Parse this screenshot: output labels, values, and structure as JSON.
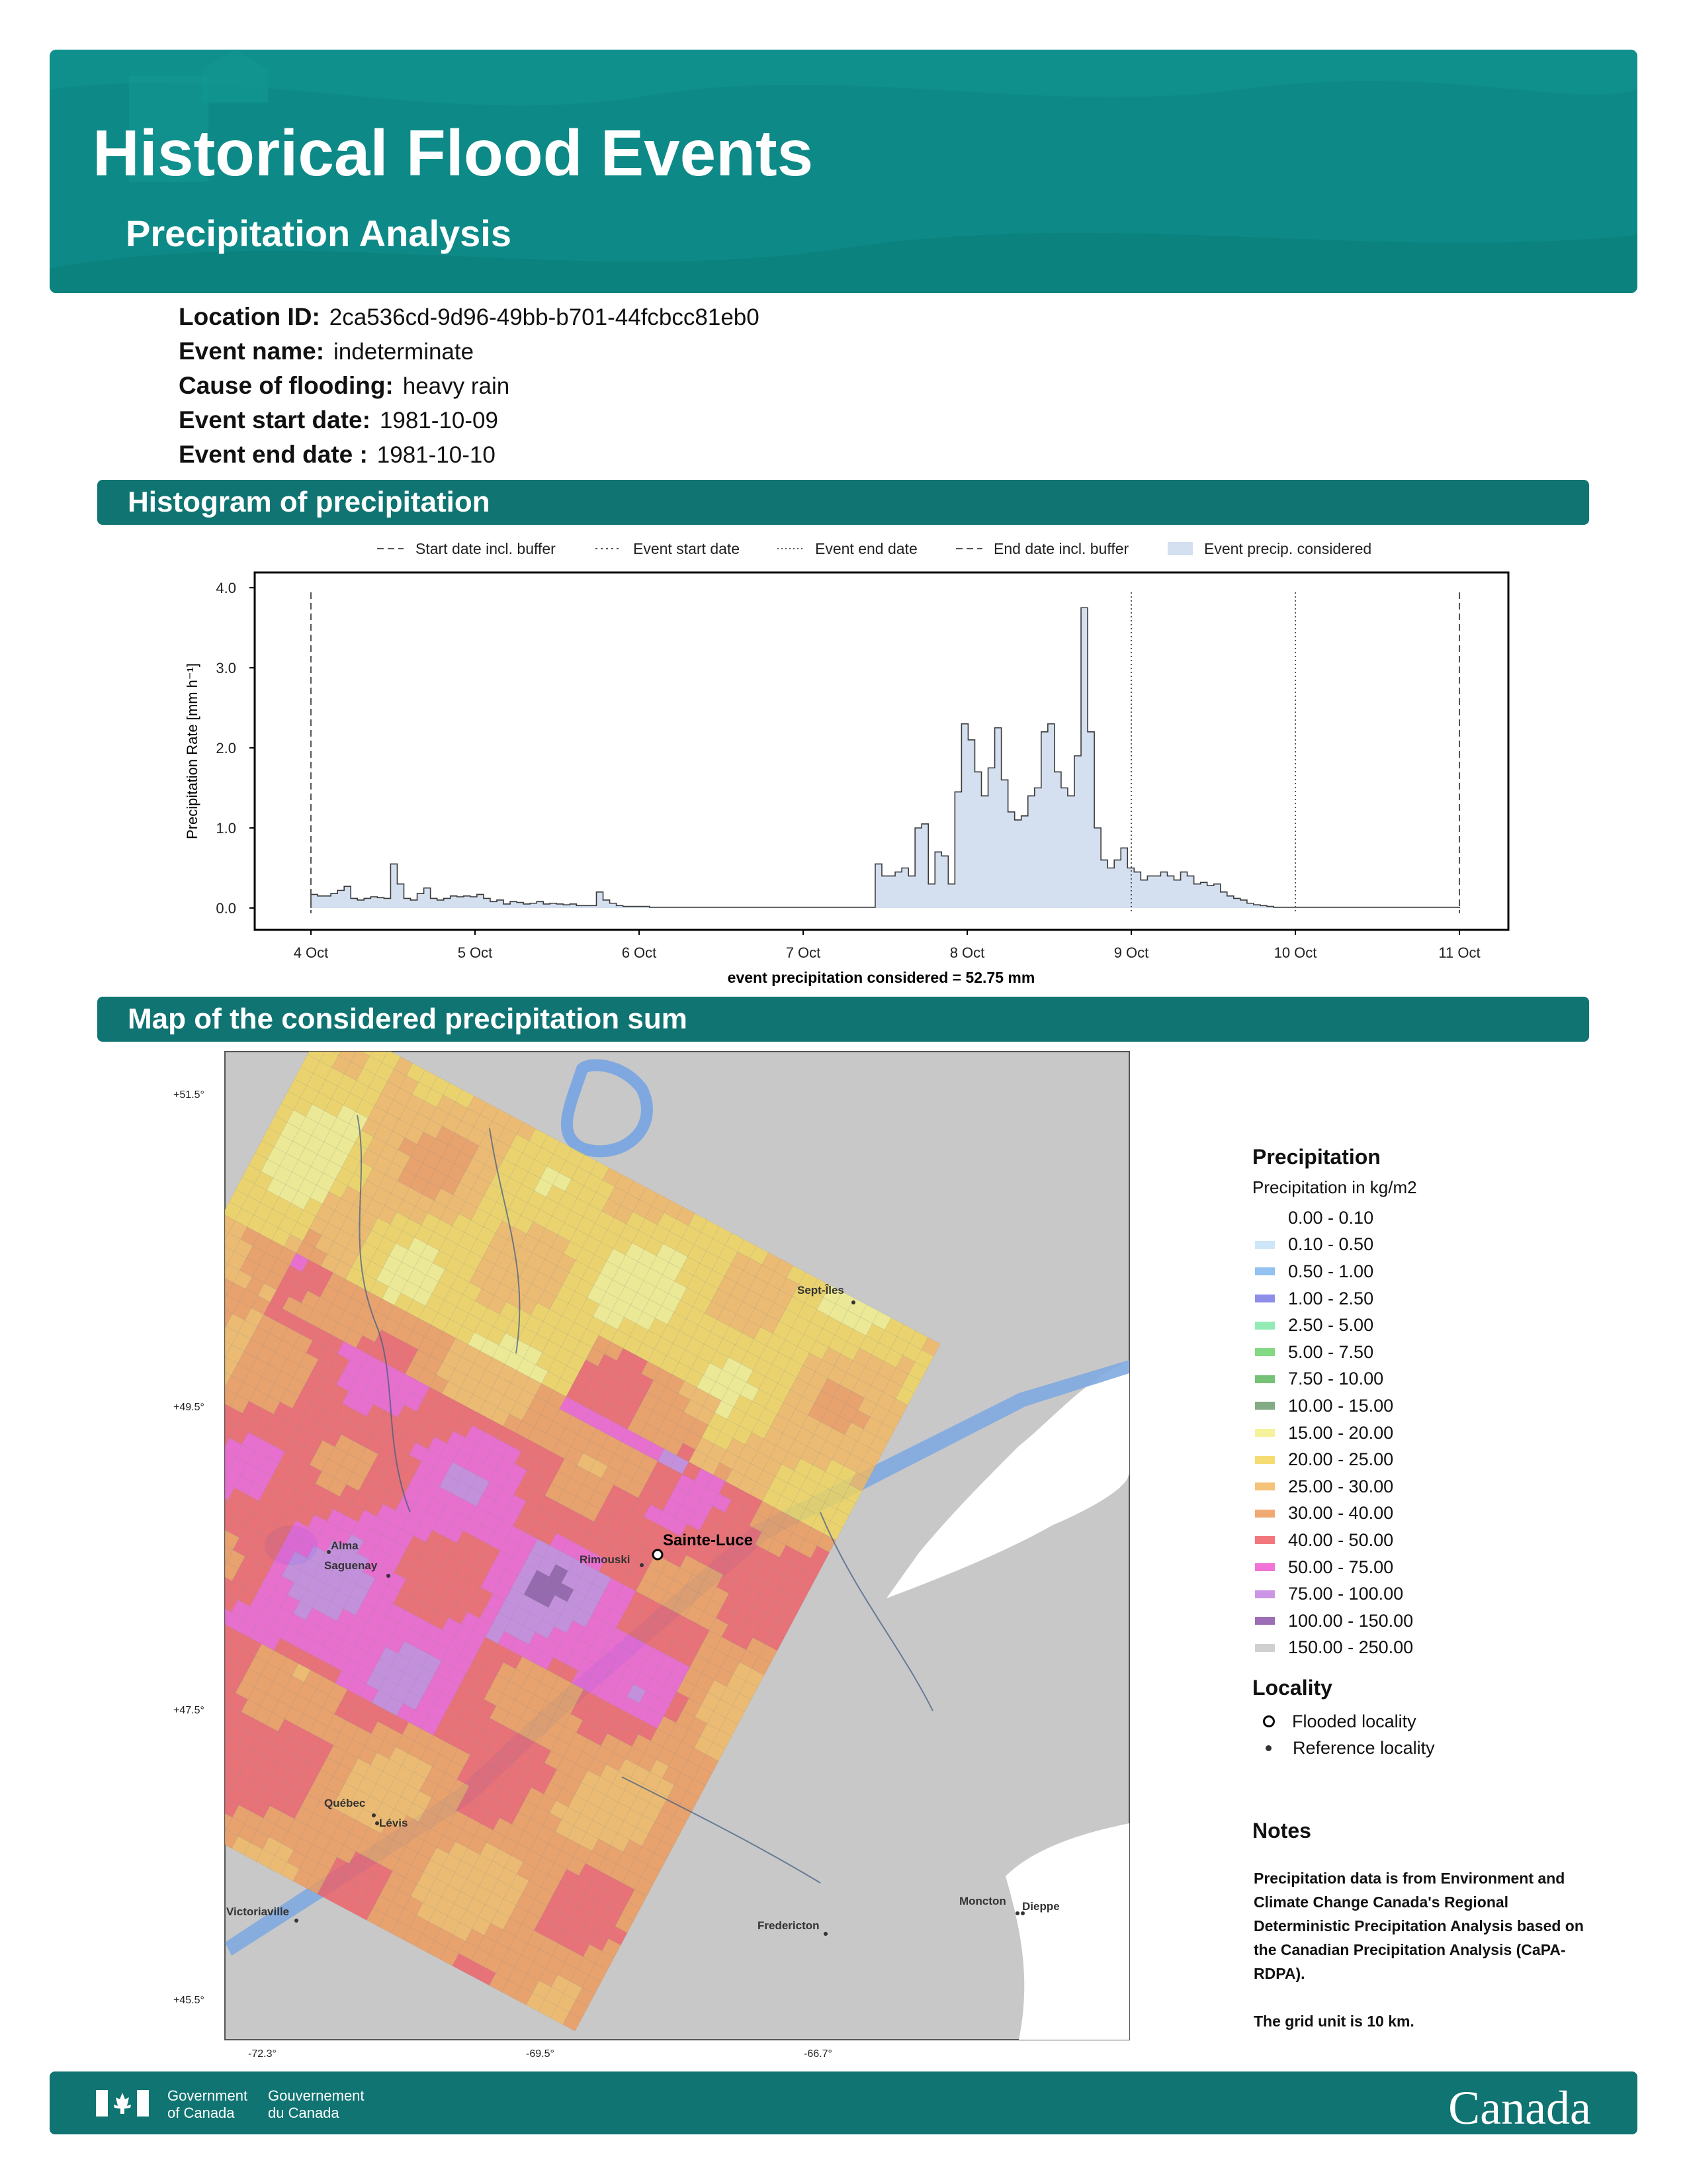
{
  "header": {
    "title": "Historical Flood Events",
    "subtitle": "Precipitation Analysis",
    "bg_color": "#0d8a87"
  },
  "meta": {
    "location_label": "Location ID:",
    "location_value": "2ca536cd-9d96-49bb-b701-44fcbcc81eb0",
    "event_label": "Event name:",
    "event_value": "indeterminate",
    "cause_label": "Cause of flooding:",
    "cause_value": "heavy rain",
    "start_label": "Event start date:",
    "start_value": "1981-10-09",
    "end_label": "Event end date :",
    "end_value": "1981-10-10"
  },
  "sections": {
    "histogram": "Histogram of precipitation",
    "map": "Map of the considered precipitation sum"
  },
  "chart_data": {
    "type": "area",
    "ylabel": "Precipitation Rate [mm h⁻¹]",
    "xlabel": "event precipitation considered = 52.75 mm",
    "ylim": [
      0,
      4.0
    ],
    "yticks": [
      "0.0",
      "1.0",
      "2.0",
      "3.0",
      "4.0"
    ],
    "xticks": [
      "4 Oct",
      "5 Oct",
      "6 Oct",
      "7 Oct",
      "8 Oct",
      "9 Oct",
      "10 Oct",
      "11 Oct"
    ],
    "legend": [
      "Start date incl. buffer",
      "Event start date",
      "Event end date",
      "End date incl. buffer",
      "Event precip. considered"
    ],
    "vlines": [
      {
        "name": "Start date incl. buffer",
        "x_day": 0.0,
        "style": "dashed"
      },
      {
        "name": "Event end date",
        "x_day": 5.0,
        "style": "dotted"
      },
      {
        "name": "Event start date",
        "x_day": 6.0,
        "style": "dotted"
      },
      {
        "name": "End date incl. buffer",
        "x_day": 7.0,
        "style": "dashed"
      }
    ],
    "series": [
      {
        "name": "Event precip. considered",
        "values": [
          0.17,
          0.15,
          0.15,
          0.18,
          0.22,
          0.27,
          0.12,
          0.1,
          0.12,
          0.14,
          0.13,
          0.12,
          0.55,
          0.3,
          0.12,
          0.1,
          0.18,
          0.25,
          0.12,
          0.1,
          0.12,
          0.15,
          0.14,
          0.15,
          0.14,
          0.17,
          0.12,
          0.08,
          0.1,
          0.05,
          0.08,
          0.07,
          0.05,
          0.06,
          0.08,
          0.05,
          0.06,
          0.05,
          0.04,
          0.05,
          0.03,
          0.03,
          0.03,
          0.2,
          0.1,
          0.06,
          0.03,
          0.02,
          0.02,
          0.02,
          0.02,
          0.01,
          0.01,
          0.01,
          0.01,
          0.01,
          0.01,
          0.01,
          0.01,
          0.01,
          0.01,
          0.01,
          0.01,
          0.01,
          0.01,
          0.01,
          0.01,
          0.01,
          0.01,
          0.01,
          0.01,
          0.01,
          0.01,
          0.01,
          0.01,
          0.01,
          0.01,
          0.01,
          0.01,
          0.01,
          0.01,
          0.01,
          0.01,
          0.01,
          0.01,
          0.55,
          0.4,
          0.4,
          0.45,
          0.5,
          0.4,
          1.0,
          1.05,
          0.3,
          0.7,
          0.65,
          0.3,
          1.45,
          2.3,
          2.1,
          1.7,
          1.4,
          1.75,
          2.25,
          1.6,
          1.2,
          1.1,
          1.15,
          1.4,
          1.5,
          2.2,
          2.3,
          1.7,
          1.5,
          1.4,
          1.9,
          3.75,
          2.2,
          1.0,
          0.6,
          0.5,
          0.6,
          0.75,
          0.5,
          0.45,
          0.35,
          0.4,
          0.4,
          0.45,
          0.4,
          0.35,
          0.45,
          0.4,
          0.3,
          0.32,
          0.28,
          0.3,
          0.2,
          0.15,
          0.12,
          0.1,
          0.06,
          0.04,
          0.03,
          0.02,
          0.01,
          0.01,
          0.01,
          0.01,
          0.01,
          0.01,
          0.01,
          0.01,
          0.01,
          0.01,
          0.01,
          0.01,
          0.01,
          0.01,
          0.01,
          0.01,
          0.01,
          0.01,
          0.01,
          0.01,
          0.01,
          0.01,
          0.01,
          0.01,
          0.01,
          0.01,
          0.01,
          0.01
        ]
      }
    ]
  },
  "map": {
    "lat_ticks": [
      "+51.5°",
      "+49.5°",
      "+47.5°",
      "+45.5°"
    ],
    "lon_ticks": [
      "-72.3°",
      "-69.5°",
      "-66.7°"
    ],
    "places": {
      "sainte_luce": "Sainte-Luce",
      "rimouski": "Rimouski",
      "sept_iles": "Sept-Îles",
      "alma": "Alma",
      "saguenay": "Saguenay",
      "quebec": "Québec",
      "levis": "Lévis",
      "victoriaville": "Victoriaville",
      "fredericton": "Fredericton",
      "moncton": "Moncton",
      "dieppe": "Dieppe"
    }
  },
  "legend": {
    "title": "Precipitation",
    "subtitle": "Precipitation in kg/m2",
    "classes": [
      {
        "label": "0.00 - 0.10",
        "color": "#ffffff"
      },
      {
        "label": "0.10 - 0.50",
        "color": "#c6e2f7"
      },
      {
        "label": "0.50 - 1.00",
        "color": "#7fb7ec"
      },
      {
        "label": "1.00 - 2.50",
        "color": "#7a7ae6"
      },
      {
        "label": "2.50 - 5.00",
        "color": "#7fe8a7"
      },
      {
        "label": "5.00 - 7.50",
        "color": "#6fd46f"
      },
      {
        "label": "7.50 - 10.00",
        "color": "#5db65d"
      },
      {
        "label": "10.00 - 15.00",
        "color": "#6f9e6f"
      },
      {
        "label": "15.00 - 20.00",
        "color": "#f3f08a"
      },
      {
        "label": "20.00 - 25.00",
        "color": "#f2d65b"
      },
      {
        "label": "25.00 - 30.00",
        "color": "#f3b860"
      },
      {
        "label": "30.00 - 40.00",
        "color": "#ee9a5a"
      },
      {
        "label": "40.00 - 50.00",
        "color": "#ee5f66"
      },
      {
        "label": "50.00 - 75.00",
        "color": "#ee5bd0"
      },
      {
        "label": "75.00 - 100.00",
        "color": "#c284e0"
      },
      {
        "label": "100.00 - 150.00",
        "color": "#8a55a8"
      },
      {
        "label": "150.00 - 250.00",
        "color": "#c8c8c8"
      }
    ],
    "locality_title": "Locality",
    "flooded": "Flooded locality",
    "reference": "Reference locality"
  },
  "notes": {
    "title": "Notes",
    "text1": "Precipitation data is from Environment and Climate Change Canada's Regional Deterministic Precipitation Analysis based on the Canadian Precipitation Analysis (CaPA-RDPA).",
    "text2": "The grid unit is 10 km."
  },
  "footer": {
    "gov_en_1": "Government",
    "gov_en_2": "of Canada",
    "gov_fr_1": "Gouvernement",
    "gov_fr_2": "du Canada",
    "wordmark": "Canada"
  }
}
